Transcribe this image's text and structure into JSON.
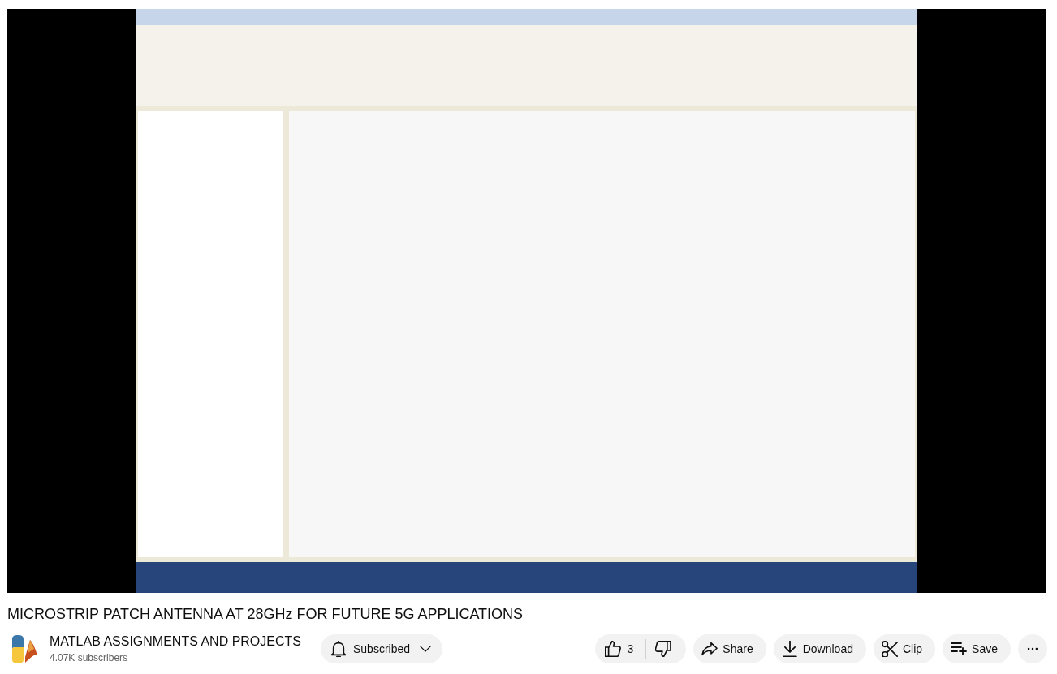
{
  "video": {
    "kind": "screen-recording"
  },
  "title": "MICROSTRIP PATCH ANTENNA AT 28GHz FOR FUTURE 5G APPLICATIONS",
  "channel": {
    "name": "MATLAB ASSIGNMENTS AND PROJECTS",
    "subscribers": "4.07K subscribers"
  },
  "subscribe_button": {
    "label": "Subscribed"
  },
  "like_button": {
    "count": "3"
  },
  "actions": [
    {
      "kind": "share",
      "label": "Share"
    },
    {
      "kind": "download",
      "label": "Download"
    },
    {
      "kind": "clip",
      "label": "Clip"
    },
    {
      "kind": "save",
      "label": "Save"
    }
  ]
}
